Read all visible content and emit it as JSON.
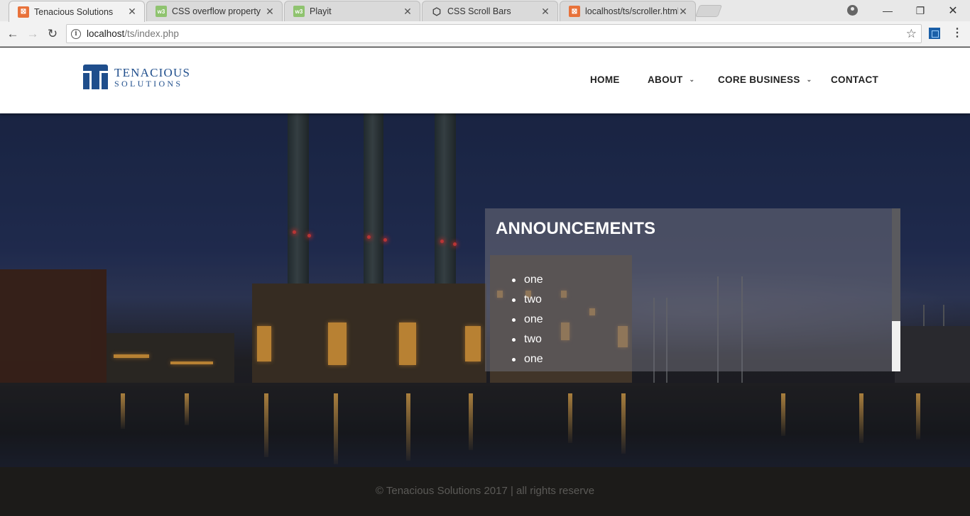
{
  "browser": {
    "tabs": [
      {
        "title": "Tenacious Solutions",
        "favicon": "xampp-icon",
        "active": true
      },
      {
        "title": "CSS overflow property",
        "favicon": "w3schools-icon",
        "active": false
      },
      {
        "title": "Playit",
        "favicon": "w3schools-icon",
        "active": false
      },
      {
        "title": "CSS Scroll Bars",
        "favicon": "codepen-icon",
        "active": false
      },
      {
        "title": "localhost/ts/scroller.html",
        "favicon": "xampp-icon",
        "active": false
      }
    ],
    "address": {
      "host": "localhost",
      "path": "/ts/index.php"
    }
  },
  "site": {
    "logo": {
      "line1": "TENACIOUS",
      "line2": "SOLUTIONS"
    },
    "nav": [
      {
        "label": "HOME",
        "has_dropdown": false
      },
      {
        "label": "ABOUT",
        "has_dropdown": true
      },
      {
        "label": "CORE BUSINESS",
        "has_dropdown": true
      },
      {
        "label": "CONTACT",
        "has_dropdown": false
      }
    ],
    "announcements": {
      "title": "ANNOUNCEMENTS",
      "items": [
        "one",
        "two",
        "one",
        "two",
        "one"
      ],
      "scroll_position": 0.69
    },
    "footer": "© Tenacious Solutions 2017 | all rights reserve"
  },
  "colors": {
    "brand": "#1f4e8c",
    "footer_bg": "#1c1b19",
    "footer_text": "#5b5a57"
  }
}
